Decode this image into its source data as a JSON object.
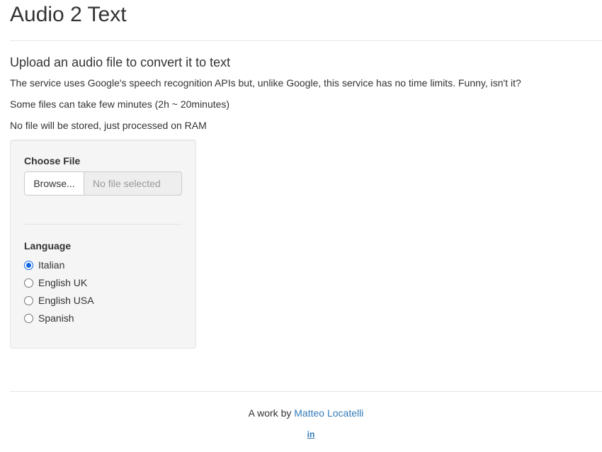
{
  "header": {
    "title": "Audio 2 Text"
  },
  "intro": {
    "heading": "Upload an audio file to convert it to text",
    "lines": [
      "The service uses Google's speech recognition APIs but, unlike Google, this service has no time limits. Funny, isn't it?",
      "Some files can take few minutes (2h ~ 20minutes)",
      "No file will be stored, just processed on RAM"
    ]
  },
  "form": {
    "file": {
      "label": "Choose File",
      "button_label": "Browse...",
      "placeholder": "No file selected"
    },
    "language": {
      "label": "Language",
      "selected": "Italian",
      "options": [
        "Italian",
        "English UK",
        "English USA",
        "Spanish"
      ]
    }
  },
  "footer": {
    "prefix": "A work by",
    "author_link": "Matteo Locatelli",
    "social_icon": "linkedin-icon",
    "link_color": "#337ab7"
  }
}
